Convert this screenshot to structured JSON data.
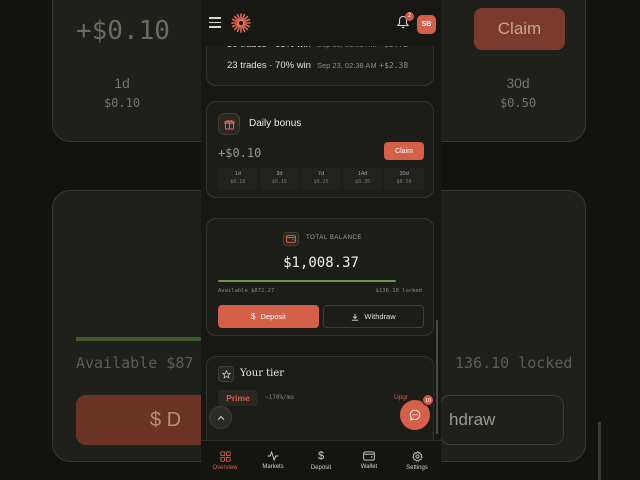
{
  "backdrop": {
    "amount": "+$0.10",
    "claim_label": "Claim",
    "periods": [
      {
        "label": "1d",
        "value": "$0.10"
      },
      {
        "label": "30d",
        "value": "$0.50"
      }
    ],
    "available": "Available $87",
    "locked": "136.10 locked",
    "deposit_label": "$ D",
    "withdraw_label": "hdraw"
  },
  "header": {
    "notification_count": "2",
    "avatar_initials": "SB"
  },
  "trades": {
    "rows": [
      {
        "summary": "30 trades · 65% win",
        "time": "Sep 23, 03:03 AM",
        "amount": "+$2.72"
      },
      {
        "summary": "23 trades · 70% win",
        "time": "Sep 23, 02:38 AM",
        "amount": "+$2.38"
      }
    ]
  },
  "daily_bonus": {
    "title": "Daily bonus",
    "amount": "+$0.10",
    "claim_label": "Claim",
    "periods": [
      {
        "label": "1d",
        "value": "$0.10"
      },
      {
        "label": "3d",
        "value": "$0.15"
      },
      {
        "label": "7d",
        "value": "$0.25"
      },
      {
        "label": "14d",
        "value": "$0.35"
      },
      {
        "label": "30d",
        "value": "$0.50"
      }
    ]
  },
  "balance": {
    "label": "TOTAL BALANCE",
    "amount": "$1,008.37",
    "available": "Available $872.27",
    "locked": "$136.10 locked",
    "available_fraction": 0.865,
    "deposit_label": "Deposit",
    "withdraw_label": "Withdraw"
  },
  "tier": {
    "title": "Your tier",
    "name": "Prime",
    "rate": "~170%/mo",
    "upgrade_label": "Upgr"
  },
  "chat": {
    "badge": "10"
  },
  "nav": {
    "items": [
      {
        "label": "Overview",
        "icon": "grid-icon",
        "active": true
      },
      {
        "label": "Markets",
        "icon": "activity-icon"
      },
      {
        "label": "Deposit",
        "icon": "dollar-icon"
      },
      {
        "label": "Wallet",
        "icon": "wallet-icon"
      },
      {
        "label": "Settings",
        "icon": "gear-icon"
      }
    ]
  },
  "colors": {
    "accent": "#d4604a",
    "progress": "#6a9a48",
    "surface": "#1c1c19",
    "background": "#171714"
  }
}
